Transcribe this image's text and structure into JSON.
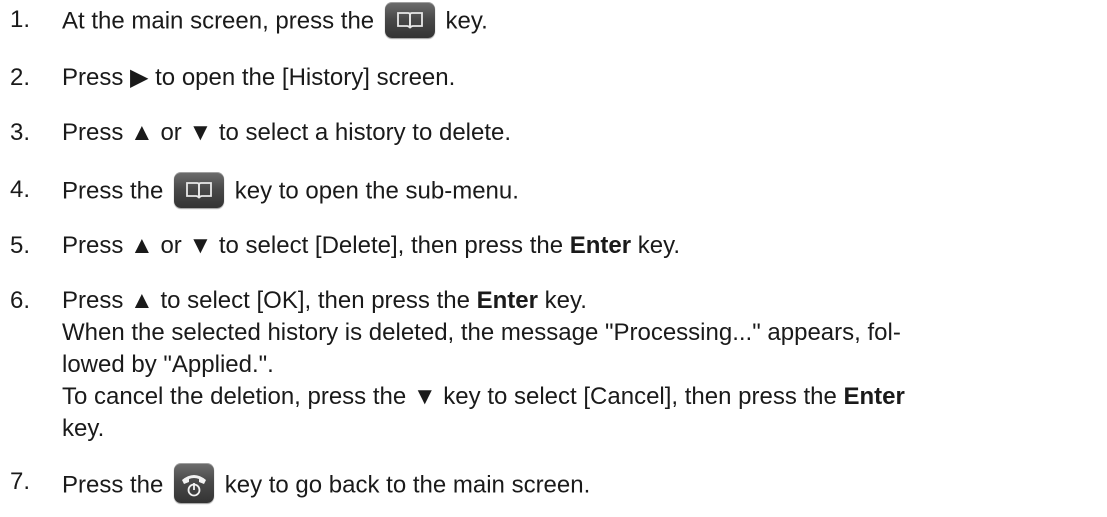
{
  "steps": [
    {
      "num": "1.",
      "a": "At the main screen, press the",
      "icon": "phonebook-key-icon",
      "b": "key."
    },
    {
      "num": "2.",
      "a": "Press ▶ to open the [History] screen."
    },
    {
      "num": "3.",
      "a": "Press ▲ or ▼ to select a history to delete."
    },
    {
      "num": "4.",
      "a": "Press the",
      "icon": "phonebook-key-icon",
      "b": "key to open the sub-menu."
    },
    {
      "num": "5.",
      "a": "Press ▲ or ▼ to select [Delete], then press the",
      "bold": "Enter",
      "b": "key."
    },
    {
      "num": "6.",
      "a": "Press ▲ to select [OK], then press the",
      "bold": "Enter",
      "b": "key.",
      "note1": "When the selected history is deleted, the message \"Processing...\" appears, fol-",
      "note2": "lowed by \"Applied.\".",
      "note3a": "To cancel the deletion, press the ▼ key to select [Cancel], then press the",
      "note3bold": "Enter",
      "note3b": "key."
    },
    {
      "num": "7.",
      "a": "Press the",
      "icon": "on-hook-key-icon",
      "b": "key to go back to the main screen."
    }
  ]
}
